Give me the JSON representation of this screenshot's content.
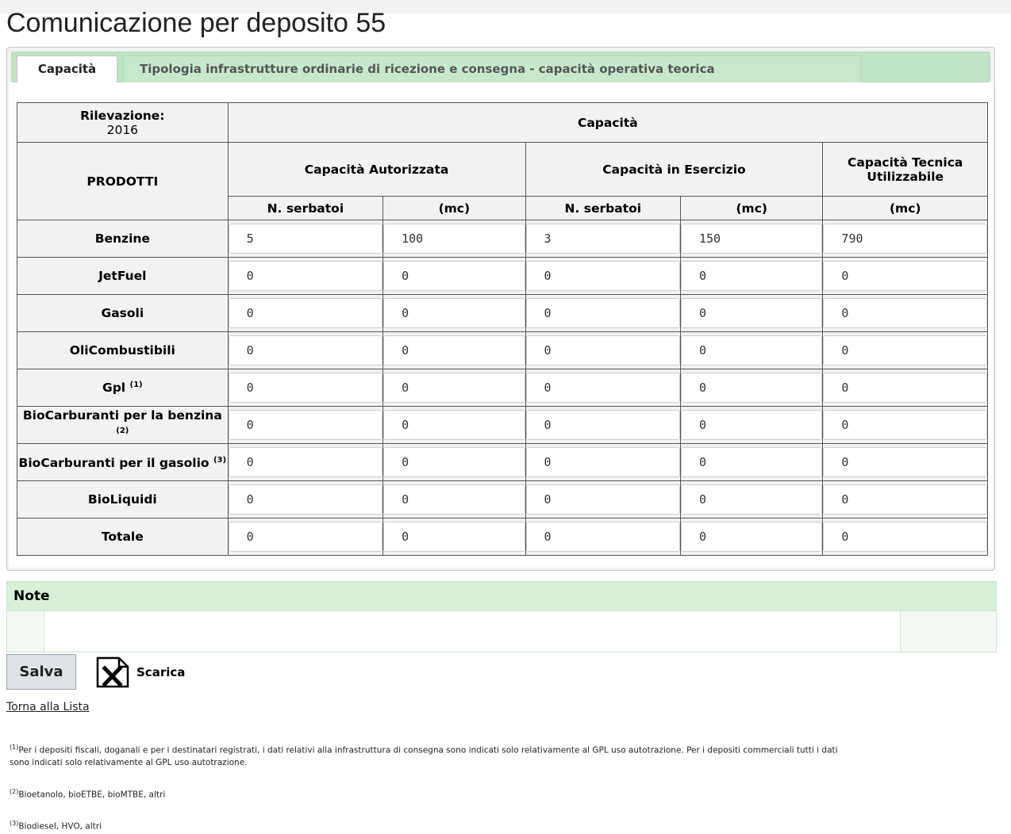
{
  "page": {
    "title": "Comunicazione per deposito 55"
  },
  "tabs": [
    "Capacità",
    "Tipologia infrastrutture ordinarie di ricezione e consegna - capacità operativa teorica"
  ],
  "table": {
    "rilevazione_label": "Rilevazione:",
    "rilevazione_year": "2016",
    "capacita_header": "Capacità",
    "prodotti_header": "PRODOTTI",
    "autorizzata_header": "Capacità Autorizzata",
    "esercizio_header": "Capacità in Esercizio",
    "tecnica_header": "Capacità Tecnica Utilizzabile",
    "subheaders": [
      "N. serbatoi",
      "(mc)",
      "N. serbatoi",
      "(mc)",
      "(mc)"
    ],
    "rows": [
      {
        "label": "Benzine",
        "note": "",
        "values": [
          "5",
          "100",
          "3",
          "150",
          "790"
        ]
      },
      {
        "label": "JetFuel",
        "note": "",
        "values": [
          "0",
          "0",
          "0",
          "0",
          "0"
        ]
      },
      {
        "label": "Gasoli",
        "note": "",
        "values": [
          "0",
          "0",
          "0",
          "0",
          "0"
        ]
      },
      {
        "label": "OliCombustibili",
        "note": "",
        "values": [
          "0",
          "0",
          "0",
          "0",
          "0"
        ]
      },
      {
        "label": "Gpl",
        "note": "(1)",
        "values": [
          "0",
          "0",
          "0",
          "0",
          "0"
        ]
      },
      {
        "label": "BioCarburanti per la benzina",
        "note": "(2)",
        "values": [
          "0",
          "0",
          "0",
          "0",
          "0"
        ]
      },
      {
        "label": "BioCarburanti per il gasolio",
        "note": "(3)",
        "values": [
          "0",
          "0",
          "0",
          "0",
          "0"
        ]
      },
      {
        "label": "BioLiquidi",
        "note": "",
        "values": [
          "0",
          "0",
          "0",
          "0",
          "0"
        ]
      },
      {
        "label": "Totale",
        "note": "",
        "values": [
          "0",
          "0",
          "0",
          "0",
          "0"
        ]
      }
    ]
  },
  "notes": {
    "header": "Note",
    "value": ""
  },
  "actions": {
    "save_label": "Salva",
    "download_label": "Scarica",
    "download_icon": "excel-icon",
    "back_label": "Torna alla Lista"
  },
  "footnotes": [
    {
      "mark": "(1)",
      "text": "Per i depositi fiscali, doganali e per i destinatari registrati, i dati relativi alla infrastruttura di consegna sono indicati solo relativamente al GPL uso autotrazione. Per i depositi commerciali tutti i dati sono indicati solo relativamente al GPL uso autotrazione."
    },
    {
      "mark": "(2)",
      "text": "Bioetanolo, bioETBE, bioMTBE, altri"
    },
    {
      "mark": "(3)",
      "text": "Biodiesel, HVO, altri"
    }
  ]
}
